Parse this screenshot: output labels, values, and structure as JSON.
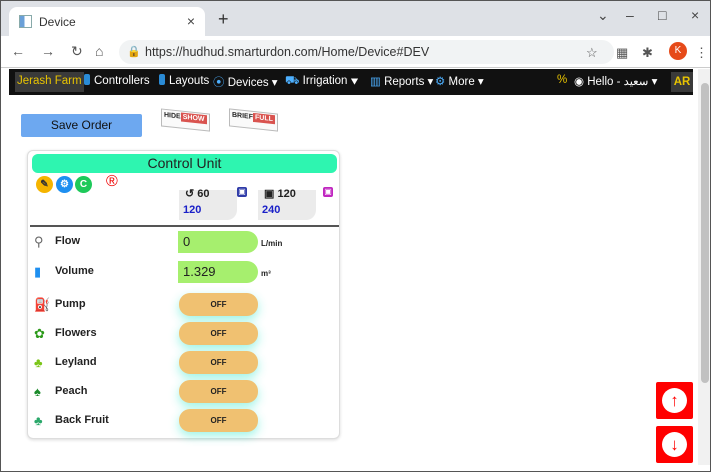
{
  "browser": {
    "tab_title": "Device",
    "tab_close": "×",
    "new_tab": "+",
    "window_minimize": "–",
    "window_maximize": "□",
    "window_close": "×",
    "url": "https://hudhud.smarturdon.com/Home/Device#DEV",
    "profile_initial": "K"
  },
  "sitenav": {
    "brand": "Jerash Farm",
    "controllers": "Controllers",
    "layouts": "Layouts",
    "devices": "Devices ▾",
    "irrigation": "Irrigation ▾",
    "reports": "Reports ▾",
    "more": "More ▾",
    "hello": "Hello - سعيد ▾",
    "lang": "AR"
  },
  "page": {
    "save_order": "Save Order",
    "hide_label": "HIDE",
    "show_label": "SHOW",
    "brief_label": "BRIEF",
    "full_label": "FULL"
  },
  "card": {
    "title": "Control Unit",
    "timer1": {
      "top": "60",
      "bottom": "120"
    },
    "timer2": {
      "top": "120",
      "bottom": "240"
    },
    "rows": [
      {
        "label": "Flow",
        "value": "0",
        "unit": "L/min"
      },
      {
        "label": "Volume",
        "value": "1.329",
        "unit": "m³"
      },
      {
        "label": "Pump",
        "state": "OFF"
      },
      {
        "label": "Flowers",
        "state": "OFF"
      },
      {
        "label": "Leyland",
        "state": "OFF"
      },
      {
        "label": "Peach",
        "state": "OFF"
      },
      {
        "label": "Back Fruit",
        "state": "OFF"
      }
    ]
  },
  "colors": {
    "title_bar": "#2ef5b0",
    "value_pill": "#a6ef6e",
    "off_button": "#f0c171",
    "save_order": "#6da8f0",
    "scroll_buttons": "#ff0000"
  }
}
